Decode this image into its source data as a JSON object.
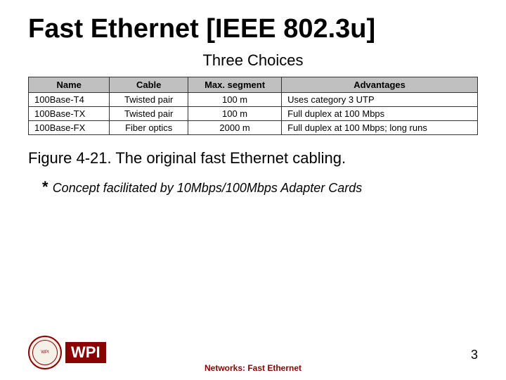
{
  "slide": {
    "title": "Fast Ethernet [IEEE 802.3u]",
    "subtitle": "Three Choices",
    "table": {
      "headers": [
        "Name",
        "Cable",
        "Max. segment",
        "Advantages"
      ],
      "rows": [
        [
          "100Base-T4",
          "Twisted pair",
          "100 m",
          "Uses category 3 UTP"
        ],
        [
          "100Base-TX",
          "Twisted pair",
          "100 m",
          "Full duplex at 100 Mbps"
        ],
        [
          "100Base-FX",
          "Fiber optics",
          "2000 m",
          "Full duplex at 100 Mbps; long runs"
        ]
      ]
    },
    "figure_caption": "Figure 4-21. The original fast Ethernet cabling.",
    "concept_note": "Concept facilitated by 10Mbps/100Mbps Adapter Cards",
    "footer": {
      "center_text": "Networks: Fast Ethernet",
      "page_number": "3",
      "logo_text": "WPI"
    }
  }
}
